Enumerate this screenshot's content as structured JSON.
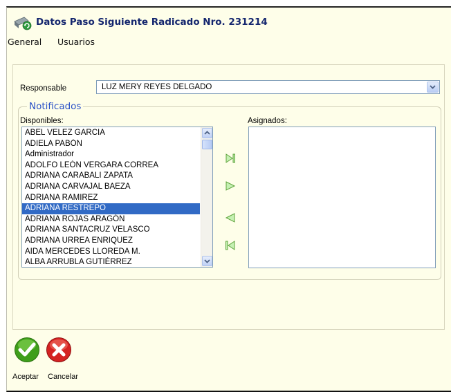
{
  "window": {
    "title": "Datos Paso Siguiente Radicado Nro. 231214"
  },
  "menu": {
    "items": [
      "General",
      "Usuarios"
    ]
  },
  "responsable": {
    "label": "Responsable",
    "value": "LUZ MERY REYES DELGADO"
  },
  "notificados": {
    "legend": "Notificados",
    "disponibles_label": "Disponibles:",
    "asignados_label": "Asignados:",
    "disponibles": [
      "ABEL VELEZ GARCIA",
      "ADIELA PABÓN",
      "Administrador",
      "ADOLFO LEÓN VERGARA CORREA",
      "ADRIANA CARABALI ZAPATA",
      "ADRIANA CARVAJAL BAEZA",
      "ADRIANA RAMIREZ",
      "ADRIANA RESTREPO",
      "ADRIANA ROJAS ARAGÓN",
      "ADRIANA SANTACRUZ VELASCO",
      "ADRIANA URREA ENRIQUEZ",
      "AIDA MERCEDES LLOREDA M.",
      "ALBA ARRUBLA GUTIÉRREZ"
    ],
    "selected": "ADRIANA RESTREPO",
    "asignados": []
  },
  "buttons": {
    "accept_label": "Aceptar",
    "cancel_label": "Cancelar"
  },
  "colors": {
    "background": "#fefee9",
    "title": "#14266e",
    "legend": "#2b52c7",
    "selection": "#316ac5",
    "accept": "#3f9e1a",
    "cancel": "#d42222"
  }
}
